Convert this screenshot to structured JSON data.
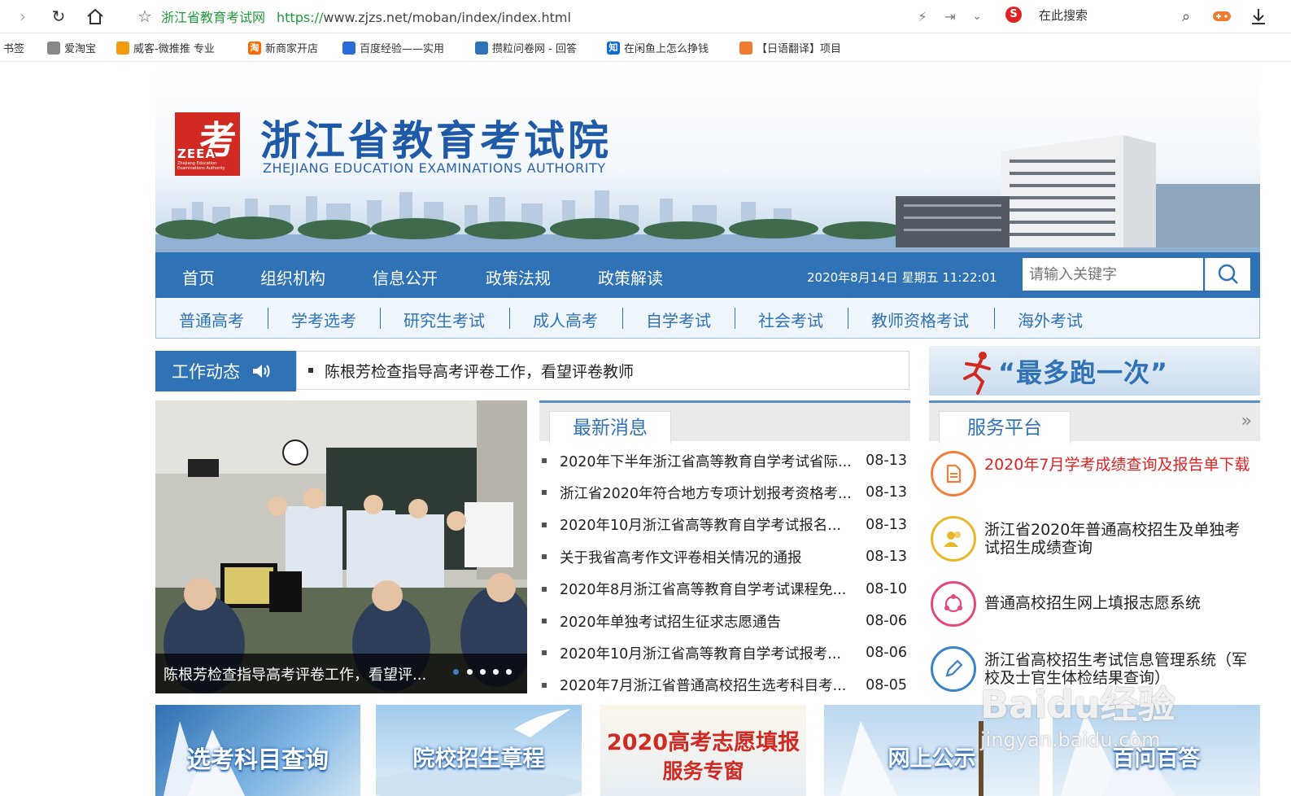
{
  "browser": {
    "tab_title": "浙江省教育考试网",
    "url_https": "https://",
    "url_rest": "www.zjzs.net/moban/index/index.html",
    "search_placeholder": "在此搜索"
  },
  "bookmarks": [
    {
      "label": "书签",
      "icon": ""
    },
    {
      "label": "爱淘宝",
      "icon": "globe-icon",
      "color": "#888888"
    },
    {
      "label": "威客-微推推 专业",
      "icon": "weike-icon",
      "color": "#f39c12"
    },
    {
      "label": "新商家开店",
      "icon": "taobao-icon",
      "color": "#ff6a00",
      "glyph": "淘"
    },
    {
      "label": "百度经验——实用",
      "icon": "baidu-paw-icon",
      "color": "#2b6bd9"
    },
    {
      "label": "攒粒问卷网 - 回答",
      "icon": "survey-icon",
      "color": "#2f72b5"
    },
    {
      "label": "在闲鱼上怎么挣钱",
      "icon": "zhihu-icon",
      "color": "#0e6cd8",
      "glyph": "知"
    },
    {
      "label": "【日语翻译】项目",
      "icon": "translate-icon",
      "color": "#f07c32"
    }
  ],
  "site": {
    "logo_text": "ZEEA",
    "logo_glyph": "考",
    "logo_small": "Zhejiang Education Examinations Authority",
    "title": "浙江省教育考试院",
    "subtitle": "ZHEJIANG EDUCATION EXAMINATIONS AUTHORITY"
  },
  "nav": {
    "items": [
      "首页",
      "组织机构",
      "信息公开",
      "政策法规",
      "政策解读"
    ],
    "datetime": "2020年8月14日 星期五 11:22:01",
    "search_placeholder": "请输入关键字"
  },
  "subnav": [
    "普通高考",
    "学考选考",
    "研究生考试",
    "成人高考",
    "自学考试",
    "社会考试",
    "教师资格考试",
    "海外考试"
  ],
  "work": {
    "label": "工作动态",
    "headline": "陈根芳检查指导高考评卷工作，看望评卷教师"
  },
  "slider": {
    "caption": "陈根芳检查指导高考评卷工作，看望评...",
    "dot_count": 5,
    "active_dot": 0
  },
  "news": {
    "tab": "最新消息",
    "items": [
      {
        "title": "2020年下半年浙江省高等教育自学考试省际...",
        "date": "08-13"
      },
      {
        "title": "浙江省2020年符合地方专项计划报考资格考...",
        "date": "08-13"
      },
      {
        "title": "2020年10月浙江省高等教育自学考试报名...",
        "date": "08-13"
      },
      {
        "title": "关于我省高考作文评卷相关情况的通报",
        "date": "08-13"
      },
      {
        "title": "2020年8月浙江省高等教育自学考试课程免...",
        "date": "08-10"
      },
      {
        "title": "2020年单独考试招生征求志愿通告",
        "date": "08-06"
      },
      {
        "title": "2020年10月浙江省高等教育自学考试报考...",
        "date": "08-06"
      },
      {
        "title": "2020年7月浙江省普通高校招生选考科目考...",
        "date": "08-05"
      }
    ]
  },
  "right": {
    "promo": "“最多跑一次”",
    "service_tab": "服务平台",
    "more": "»",
    "services": [
      {
        "text": "2020年7月学考成绩查询及报告单下载",
        "color": "#ef7f3a",
        "text_color": "#e02222",
        "icon": "document-icon"
      },
      {
        "text": "浙江省2020年普通高校招生及单独考试招生成绩查询",
        "color": "#e9b829",
        "text_color": "#222222",
        "icon": "users-icon"
      },
      {
        "text": "普通高校招生网上填报志愿系统",
        "color": "#e6497b",
        "text_color": "#222222",
        "icon": "network-icon"
      },
      {
        "text": "浙江省高校招生考试信息管理系统（军校及士官生体检结果查询）",
        "color": "#3b82c7",
        "text_color": "#222222",
        "icon": "pencil-icon"
      }
    ]
  },
  "tiles": [
    {
      "label": "选考科目查询",
      "bg": "#3e8fd0"
    },
    {
      "label": "院校招生章程",
      "bg": "#6fb0e0"
    },
    {
      "label": "2020高考志愿填报",
      "label2": "服务专窗",
      "bg": "#ffffff"
    },
    {
      "label": "网上公示",
      "bg": "#8bbfe6"
    },
    {
      "label": "百问百答",
      "bg": "#7fb6e3"
    }
  ],
  "watermark": {
    "line1": "Baidu经验",
    "line2": "jingyan.baidu.com"
  }
}
